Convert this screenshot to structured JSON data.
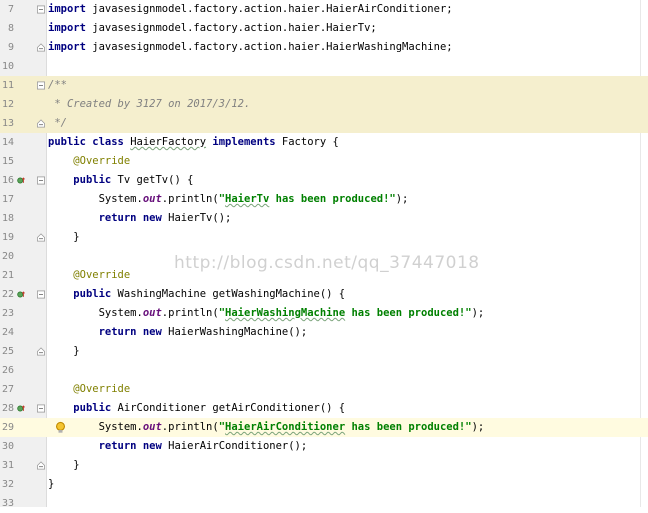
{
  "editor": {
    "watermark": "http://blog.csdn.net/qq_37447018",
    "lines": [
      {
        "n": "7",
        "bg": "",
        "gutter": [
          "fold"
        ],
        "tokens": [
          {
            "t": "import",
            "c": "kw"
          },
          {
            "t": " javasesignmodel.factory.action.haier.HaierAirConditioner;"
          }
        ]
      },
      {
        "n": "8",
        "bg": "",
        "gutter": [],
        "tokens": [
          {
            "t": "import",
            "c": "kw"
          },
          {
            "t": " javasesignmodel.factory.action.haier.HaierTv;"
          }
        ]
      },
      {
        "n": "9",
        "bg": "",
        "gutter": [
          "fold-end"
        ],
        "tokens": [
          {
            "t": "import",
            "c": "kw"
          },
          {
            "t": " javasesignmodel.factory.action.haier.HaierWashingMachine;"
          }
        ]
      },
      {
        "n": "10",
        "bg": "",
        "gutter": [],
        "tokens": []
      },
      {
        "n": "11",
        "bg": "doc",
        "gutter": [
          "fold"
        ],
        "tokens": [
          {
            "t": "/**",
            "c": "cmt"
          }
        ]
      },
      {
        "n": "12",
        "bg": "doc",
        "gutter": [],
        "tokens": [
          {
            "t": " * Created by 3127 on 2017/3/12.",
            "c": "cmt"
          }
        ]
      },
      {
        "n": "13",
        "bg": "doc",
        "gutter": [
          "fold-end"
        ],
        "tokens": [
          {
            "t": " */",
            "c": "cmt"
          }
        ]
      },
      {
        "n": "14",
        "bg": "",
        "gutter": [],
        "tokens": [
          {
            "t": "public class ",
            "c": "kw"
          },
          {
            "t": "HaierFactory",
            "c": "squig"
          },
          {
            "t": " "
          },
          {
            "t": "implements",
            "c": "kw"
          },
          {
            "t": " Factory {"
          }
        ]
      },
      {
        "n": "15",
        "bg": "",
        "gutter": [],
        "tokens": [
          {
            "t": "    "
          },
          {
            "t": "@Override",
            "c": "ann"
          }
        ]
      },
      {
        "n": "16",
        "bg": "",
        "gutter": [
          "impl",
          "fold"
        ],
        "tokens": [
          {
            "t": "    "
          },
          {
            "t": "public",
            "c": "kw"
          },
          {
            "t": " Tv getTv() {"
          }
        ]
      },
      {
        "n": "17",
        "bg": "",
        "gutter": [],
        "tokens": [
          {
            "t": "        System."
          },
          {
            "t": "out",
            "c": "fld"
          },
          {
            "t": ".println("
          },
          {
            "t": "\"",
            "c": "str"
          },
          {
            "t": "HaierTv",
            "c": "str squig"
          },
          {
            "t": " has been produced!\"",
            "c": "str"
          },
          {
            "t": ");"
          }
        ]
      },
      {
        "n": "18",
        "bg": "",
        "gutter": [],
        "tokens": [
          {
            "t": "        "
          },
          {
            "t": "return new",
            "c": "kw"
          },
          {
            "t": " HaierTv();"
          }
        ]
      },
      {
        "n": "19",
        "bg": "",
        "gutter": [
          "fold-end"
        ],
        "tokens": [
          {
            "t": "    }"
          }
        ]
      },
      {
        "n": "20",
        "bg": "",
        "gutter": [],
        "tokens": []
      },
      {
        "n": "21",
        "bg": "",
        "gutter": [],
        "tokens": [
          {
            "t": "    "
          },
          {
            "t": "@Override",
            "c": "ann"
          }
        ]
      },
      {
        "n": "22",
        "bg": "",
        "gutter": [
          "impl",
          "fold"
        ],
        "tokens": [
          {
            "t": "    "
          },
          {
            "t": "public",
            "c": "kw"
          },
          {
            "t": " WashingMachine getWashingMachine() {"
          }
        ]
      },
      {
        "n": "23",
        "bg": "",
        "gutter": [],
        "tokens": [
          {
            "t": "        System."
          },
          {
            "t": "out",
            "c": "fld"
          },
          {
            "t": ".println("
          },
          {
            "t": "\"",
            "c": "str"
          },
          {
            "t": "HaierWashingMachine",
            "c": "str squig"
          },
          {
            "t": " has been produced!\"",
            "c": "str"
          },
          {
            "t": ");"
          }
        ]
      },
      {
        "n": "24",
        "bg": "",
        "gutter": [],
        "tokens": [
          {
            "t": "        "
          },
          {
            "t": "return new",
            "c": "kw"
          },
          {
            "t": " HaierWashingMachine();"
          }
        ]
      },
      {
        "n": "25",
        "bg": "",
        "gutter": [
          "fold-end"
        ],
        "tokens": [
          {
            "t": "    }"
          }
        ]
      },
      {
        "n": "26",
        "bg": "",
        "gutter": [],
        "tokens": []
      },
      {
        "n": "27",
        "bg": "",
        "gutter": [],
        "tokens": [
          {
            "t": "    "
          },
          {
            "t": "@Override",
            "c": "ann"
          }
        ]
      },
      {
        "n": "28",
        "bg": "",
        "gutter": [
          "impl",
          "fold"
        ],
        "tokens": [
          {
            "t": "    "
          },
          {
            "t": "public",
            "c": "kw"
          },
          {
            "t": " AirConditioner getAirConditioner() {"
          }
        ]
      },
      {
        "n": "29",
        "bg": "caret",
        "gutter": [
          "bulb"
        ],
        "tokens": [
          {
            "t": "        System."
          },
          {
            "t": "out",
            "c": "fld"
          },
          {
            "t": ".println("
          },
          {
            "t": "\"",
            "c": "str"
          },
          {
            "t": "HaierAirConditioner",
            "c": "str squig"
          },
          {
            "t": " has been produced!\"",
            "c": "str"
          },
          {
            "t": ");"
          }
        ]
      },
      {
        "n": "30",
        "bg": "",
        "gutter": [],
        "tokens": [
          {
            "t": "        "
          },
          {
            "t": "return new",
            "c": "kw"
          },
          {
            "t": " HaierAirConditioner();"
          }
        ]
      },
      {
        "n": "31",
        "bg": "",
        "gutter": [
          "fold-end"
        ],
        "tokens": [
          {
            "t": "    }"
          }
        ]
      },
      {
        "n": "32",
        "bg": "",
        "gutter": [],
        "tokens": [
          {
            "t": "}"
          }
        ]
      },
      {
        "n": "33",
        "bg": "",
        "gutter": [],
        "tokens": []
      }
    ]
  }
}
